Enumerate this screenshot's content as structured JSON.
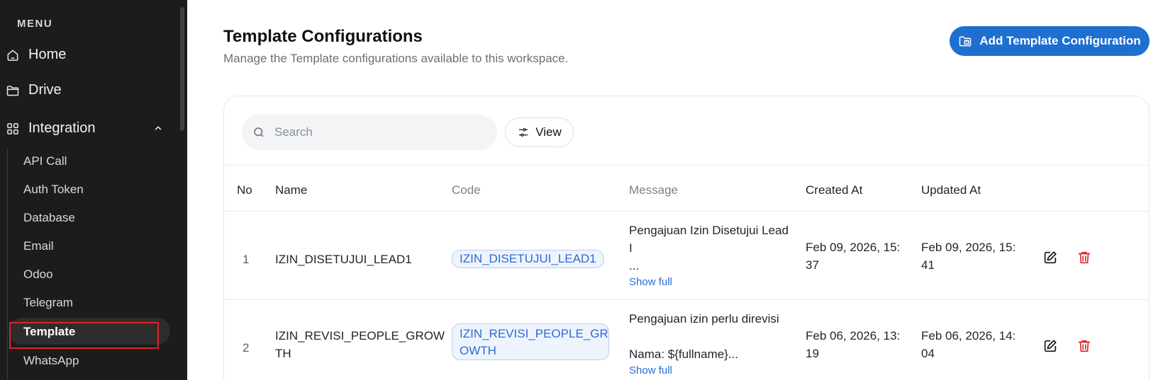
{
  "sidebar": {
    "menu_label": "MENU",
    "home": "Home",
    "drive": "Drive",
    "integration": "Integration",
    "sub_items": [
      "API Call",
      "Auth Token",
      "Database",
      "Email",
      "Odoo",
      "Telegram",
      "Template",
      "WhatsApp"
    ],
    "active_item": "Template"
  },
  "header": {
    "title": "Template Configurations",
    "subtitle": "Manage the Template configurations available to this workspace.",
    "add_button": "Add Template Configuration"
  },
  "toolbar": {
    "search_placeholder": "Search",
    "view_label": "View"
  },
  "table": {
    "columns": [
      "No",
      "Name",
      "Code",
      "Message",
      "Created At",
      "Updated At"
    ],
    "rows": [
      {
        "no": "1",
        "name": "IZIN_DISETUJUI_LEAD1",
        "code": "IZIN_DISETUJUI_LEAD1",
        "message_line1": "Pengajuan Izin Disetujui Lead",
        "message_line2": "I",
        "message_line3": "...",
        "show_full": "Show full",
        "created_l1": "Feb 09, 2026, 15:",
        "created_l2": "37",
        "updated_l1": "Feb 09, 2026, 15:",
        "updated_l2": "41"
      },
      {
        "no": "2",
        "name_l1": "IZIN_REVISI_PEOPLE_GROW",
        "name_l2": "TH",
        "code_l1": "IZIN_REVISI_PEOPLE_GR",
        "code_l2": "OWTH",
        "message_line1": "Pengajuan izin perlu direvisi",
        "message_line2": "Nama: ${fullname}...",
        "show_full": "Show full",
        "created_l1": "Feb 06, 2026, 13:",
        "created_l2": "19",
        "updated_l1": "Feb 06, 2026, 14:",
        "updated_l2": "04"
      }
    ]
  },
  "colors": {
    "sidebar_bg": "#1c1c1c",
    "accent": "#1f6fd1",
    "delete": "#e02424",
    "highlight": "#e02424"
  },
  "icons": [
    "home-icon",
    "folder-icon",
    "grid-icon",
    "chevron-up-icon",
    "search-icon",
    "sliders-icon",
    "add-template-icon",
    "edit-icon",
    "trash-icon"
  ]
}
